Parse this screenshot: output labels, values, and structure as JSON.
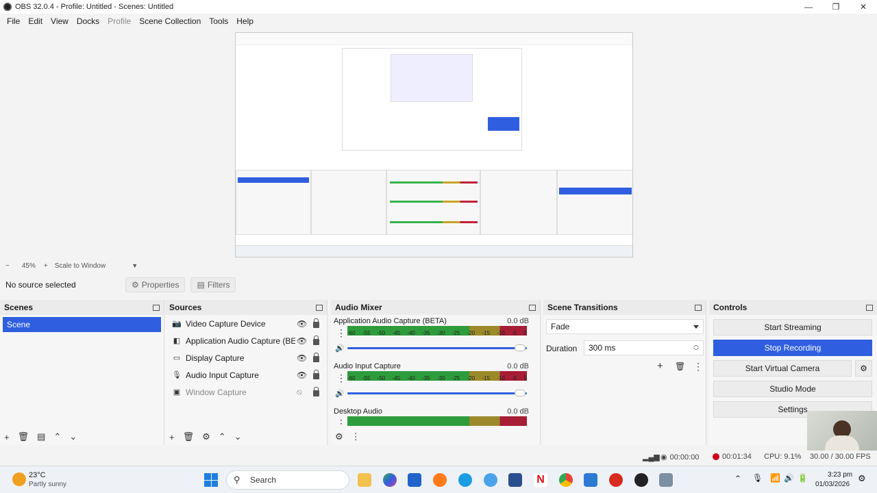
{
  "window": {
    "title": "OBS 32.0.4 - Profile: Untitled - Scenes: Untitled",
    "minimize": "—",
    "maximize": "❐",
    "close": "✕"
  },
  "menu": [
    "File",
    "Edit",
    "View",
    "Docks",
    "Profile",
    "Scene Collection",
    "Tools",
    "Help"
  ],
  "preview": {
    "zoom_minus": "−",
    "zoom_value": "45%",
    "zoom_plus": "+",
    "scale_mode": "Scale to Window"
  },
  "source_bar": {
    "status": "No source selected",
    "properties": "Properties",
    "filters": "Filters"
  },
  "scenes": {
    "title": "Scenes",
    "items": [
      "Scene"
    ]
  },
  "sources": {
    "title": "Sources",
    "items": [
      {
        "label": "Video Capture Device",
        "icon": "camera-icon"
      },
      {
        "label": "Application Audio Capture (BETA)",
        "icon": "app-audio-icon"
      },
      {
        "label": "Display Capture",
        "icon": "monitor-icon"
      },
      {
        "label": "Audio Input Capture",
        "icon": "microphone-icon"
      },
      {
        "label": "Window Capture",
        "icon": "window-icon"
      }
    ]
  },
  "mixer": {
    "title": "Audio Mixer",
    "ticks": [
      "-60",
      "-55",
      "-50",
      "-45",
      "-40",
      "-35",
      "-30",
      "-25",
      "-20",
      "-15",
      "-10",
      "-5",
      "0"
    ],
    "channels": [
      {
        "name": "Application Audio Capture (BETA)",
        "db": "0.0 dB"
      },
      {
        "name": "Audio Input Capture",
        "db": "0.0 dB"
      },
      {
        "name": "Desktop Audio",
        "db": "0.0 dB"
      }
    ]
  },
  "transitions": {
    "title": "Scene Transitions",
    "selected": "Fade",
    "duration_label": "Duration",
    "duration_value": "300 ms"
  },
  "controls": {
    "title": "Controls",
    "start_streaming": "Start Streaming",
    "stop_recording": "Stop Recording",
    "start_virtual_camera": "Start Virtual Camera",
    "studio_mode": "Studio Mode",
    "settings": "Settings"
  },
  "status": {
    "stream_time": "00:00:00",
    "record_time": "00:01:34",
    "cpu": "CPU: 9.1%",
    "fps": "30.00 / 30.00 FPS"
  },
  "taskbar": {
    "weather_temp": "23°C",
    "weather_desc": "Partly sunny",
    "search": "Search",
    "time": "3:23 pm",
    "date": "01/03/2026"
  },
  "colors": {
    "accent": "#2f5fe0",
    "record": "#d0021b"
  }
}
